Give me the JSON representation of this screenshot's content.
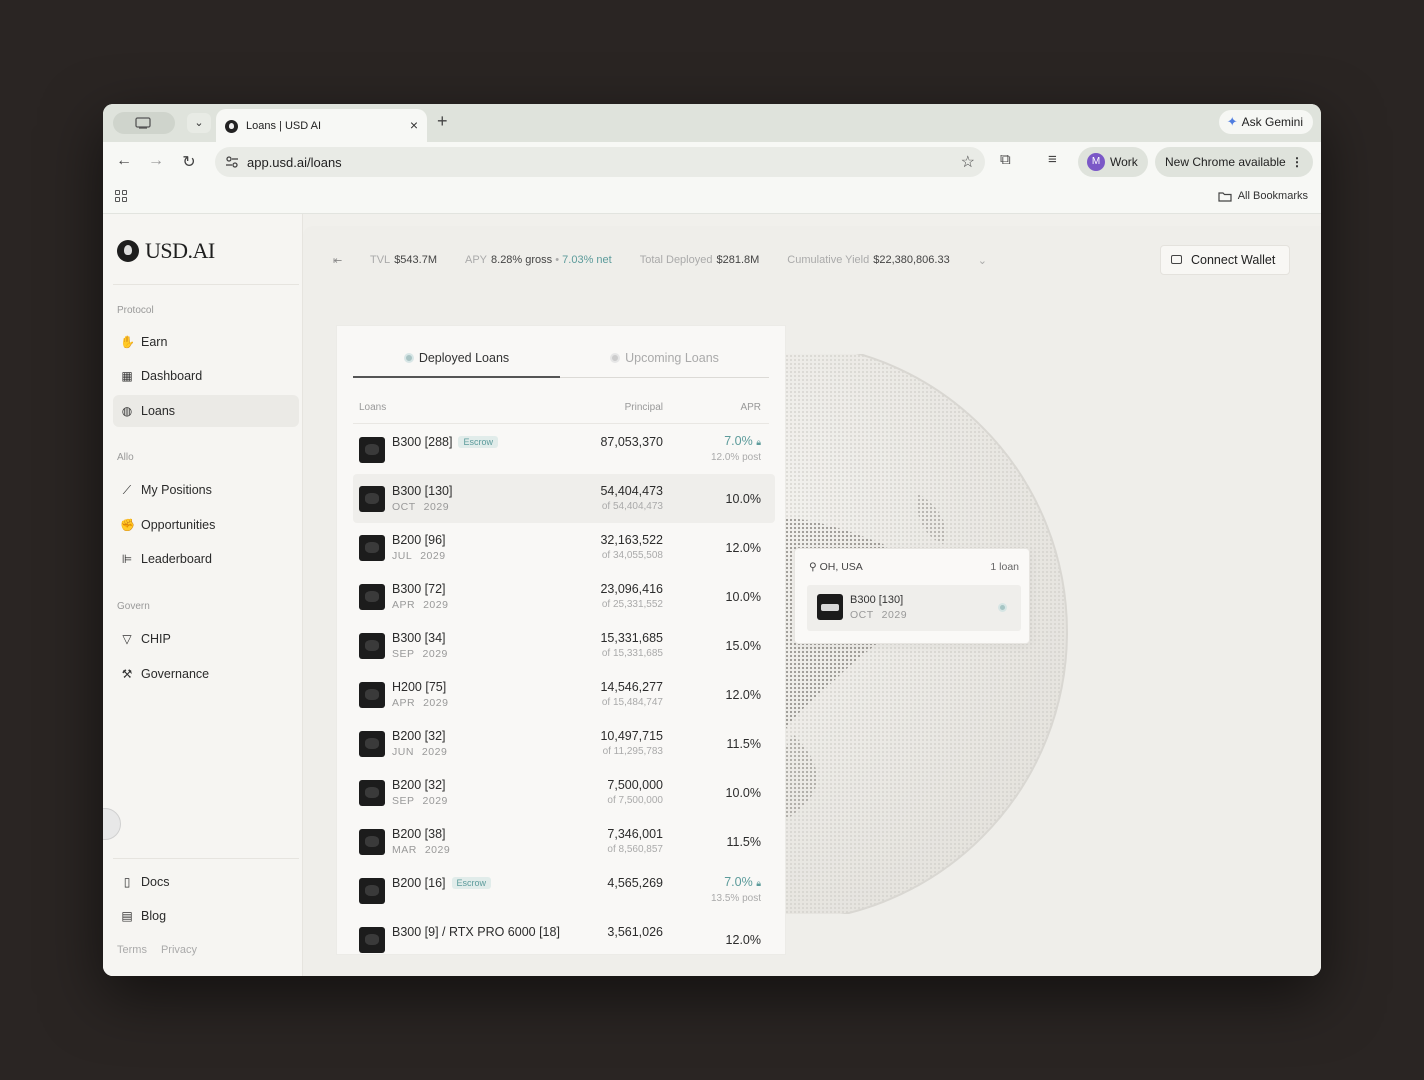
{
  "browser": {
    "tab_title": "Loans | USD AI",
    "url": "app.usd.ai/loans",
    "gemini": "Ask Gemini",
    "profile_initial": "M",
    "profile": "Work",
    "update": "New Chrome available",
    "all_bookmarks": "All Bookmarks"
  },
  "app": {
    "logo": "USD.AI",
    "sections": {
      "protocol": "Protocol",
      "allo": "Allo",
      "govern": "Govern"
    },
    "nav": {
      "earn": "Earn",
      "dashboard": "Dashboard",
      "loans": "Loans",
      "my_positions": "My Positions",
      "opportunities": "Opportunities",
      "leaderboard": "Leaderboard",
      "chip": "CHIP",
      "governance": "Governance",
      "docs": "Docs",
      "blog": "Blog"
    },
    "footer": {
      "terms": "Terms",
      "privacy": "Privacy"
    }
  },
  "stats": {
    "tvl_label": "TVL",
    "tvl": "$543.7M",
    "apy_label": "APY",
    "apy_gross": "8.28% gross",
    "apy_sep": "•",
    "apy_net": "7.03% net",
    "deployed_label": "Total Deployed",
    "deployed": "$281.8M",
    "yield_label": "Cumulative Yield",
    "yield": "$22,380,806.33"
  },
  "connect_wallet": "Connect Wallet",
  "tabs": {
    "deployed": "Deployed Loans",
    "upcoming": "Upcoming Loans"
  },
  "columns": {
    "loans": "Loans",
    "principal": "Principal",
    "apr": "APR"
  },
  "loans": [
    {
      "name": "B300 [288]",
      "badge": "Escrow",
      "month": "",
      "year": "",
      "principal": "87,053,370",
      "of": "",
      "apr": "7.0%",
      "post": "12.0% post"
    },
    {
      "name": "B300 [130]",
      "badge": "",
      "month": "OCT",
      "year": "2029",
      "principal": "54,404,473",
      "of": "of 54,404,473",
      "apr": "10.0%",
      "post": ""
    },
    {
      "name": "B200 [96]",
      "badge": "",
      "month": "JUL",
      "year": "2029",
      "principal": "32,163,522",
      "of": "of 34,055,508",
      "apr": "12.0%",
      "post": ""
    },
    {
      "name": "B300 [72]",
      "badge": "",
      "month": "APR",
      "year": "2029",
      "principal": "23,096,416",
      "of": "of 25,331,552",
      "apr": "10.0%",
      "post": ""
    },
    {
      "name": "B300 [34]",
      "badge": "",
      "month": "SEP",
      "year": "2029",
      "principal": "15,331,685",
      "of": "of 15,331,685",
      "apr": "15.0%",
      "post": ""
    },
    {
      "name": "H200 [75]",
      "badge": "",
      "month": "APR",
      "year": "2029",
      "principal": "14,546,277",
      "of": "of 15,484,747",
      "apr": "12.0%",
      "post": ""
    },
    {
      "name": "B200 [32]",
      "badge": "",
      "month": "JUN",
      "year": "2029",
      "principal": "10,497,715",
      "of": "of 11,295,783",
      "apr": "11.5%",
      "post": ""
    },
    {
      "name": "B200 [32]",
      "badge": "",
      "month": "SEP",
      "year": "2029",
      "principal": "7,500,000",
      "of": "of 7,500,000",
      "apr": "10.0%",
      "post": ""
    },
    {
      "name": "B200 [38]",
      "badge": "",
      "month": "MAR",
      "year": "2029",
      "principal": "7,346,001",
      "of": "of 8,560,857",
      "apr": "11.5%",
      "post": ""
    },
    {
      "name": "B200 [16]",
      "badge": "Escrow",
      "month": "",
      "year": "",
      "principal": "4,565,269",
      "of": "",
      "apr": "7.0%",
      "post": "13.5% post"
    },
    {
      "name": "B300 [9] / RTX PRO 6000 [18]",
      "badge": "",
      "month": "",
      "year": "",
      "principal": "3,561,026",
      "of": "",
      "apr": "12.0%",
      "post": ""
    }
  ],
  "popup": {
    "location": "OH, USA",
    "count": "1 loan",
    "name": "B300 [130]",
    "month": "OCT",
    "year": "2029"
  },
  "colors": {
    "accent": "#5c9b9b",
    "marker_teal": "#5f8f93",
    "marker_blue": "#6c80b3"
  }
}
